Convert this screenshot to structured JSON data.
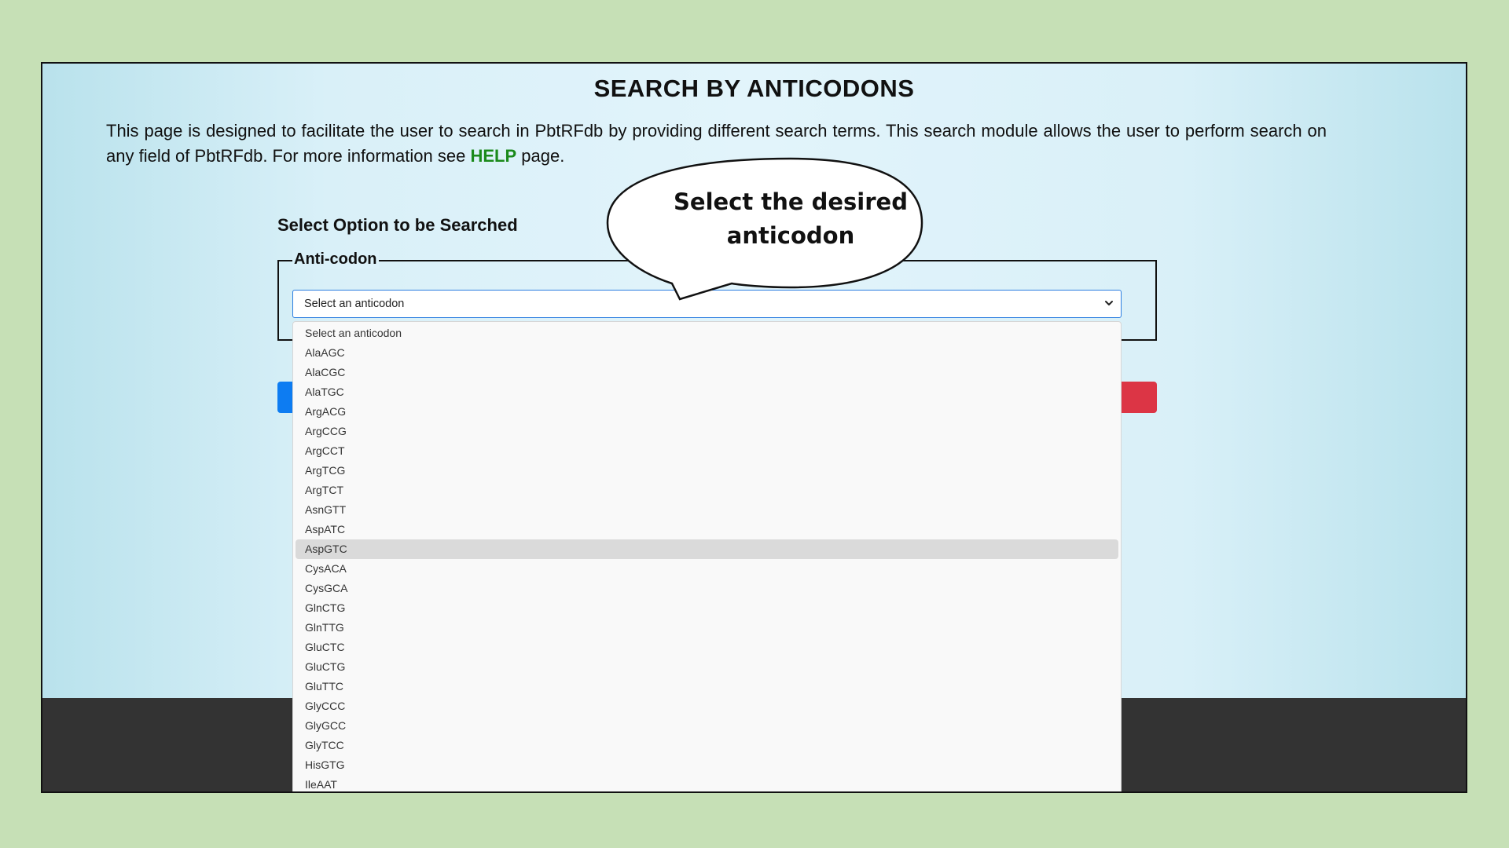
{
  "page": {
    "title": "SEARCH BY ANTICODONS",
    "intro_text": "This page is designed to facilitate the user to search in PbtRFdb by providing different search terms. This search module allows the user to perform search on any field of PbtRFdb. For more information see",
    "help_link": "HELP",
    "intro_suffix": "page."
  },
  "form": {
    "heading": "Select Option to be Searched",
    "legend": "Anti-codon",
    "select_value": "Select an anticodon"
  },
  "dropdown": {
    "options": [
      "Select an anticodon",
      "AlaAGC",
      "AlaCGC",
      "AlaTGC",
      "ArgACG",
      "ArgCCG",
      "ArgCCT",
      "ArgTCG",
      "ArgTCT",
      "AsnGTT",
      "AspATC",
      "AspGTC",
      "CysACA",
      "CysGCA",
      "GlnCTG",
      "GlnTTG",
      "GluCTC",
      "GluCTG",
      "GluTTC",
      "GlyCCC",
      "GlyGCC",
      "GlyTCC",
      "HisGTG",
      "IleAAT"
    ],
    "highlighted": "AspGTC"
  },
  "callout": {
    "line1": "Select the desired",
    "line2": "anticodon"
  },
  "colors": {
    "background": "#c6e0b6",
    "help_link": "#1a8a1a",
    "submit_button": "#0d7cf2",
    "reset_button": "#dc3545",
    "footer": "#333333",
    "select_border": "#2b7de0"
  }
}
